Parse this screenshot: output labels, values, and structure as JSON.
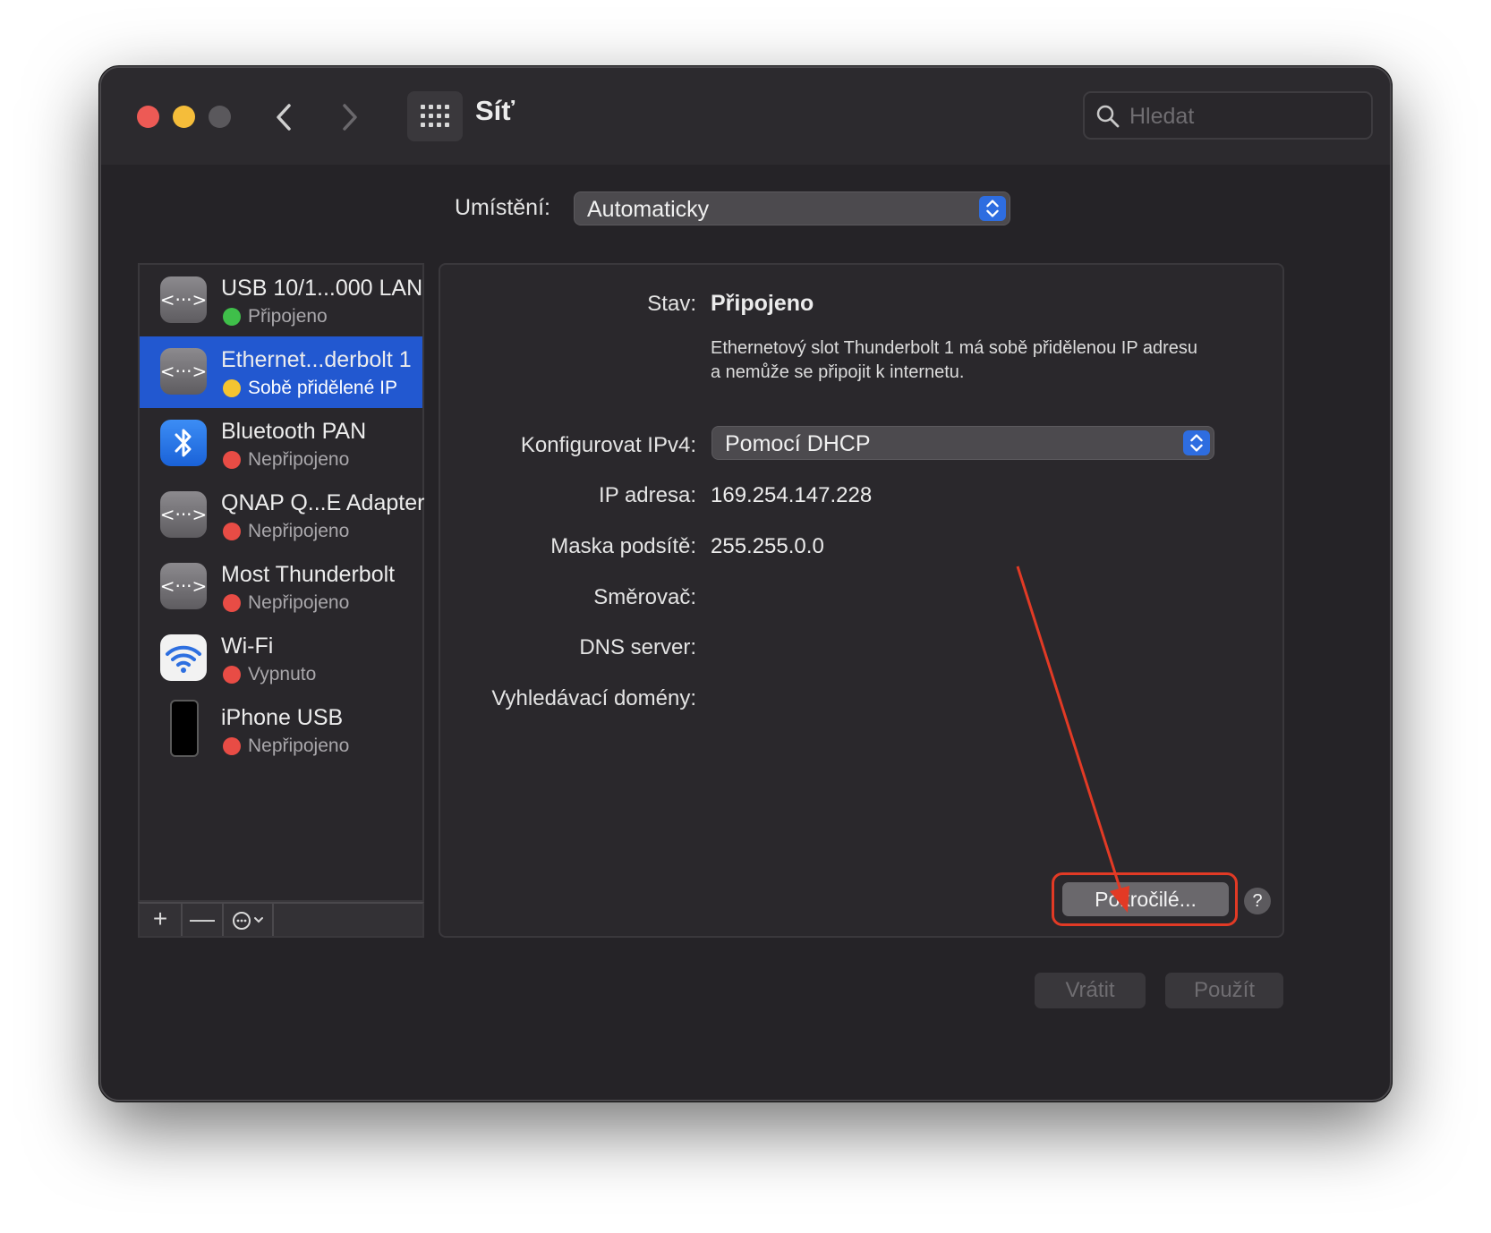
{
  "window": {
    "title": "Síť",
    "search_placeholder": "Hledat"
  },
  "location": {
    "label": "Umístění:",
    "value": "Automaticky"
  },
  "services": [
    {
      "name": "USB 10/1...000 LAN",
      "status": "Připojeno",
      "status_color": "#3fbf4a",
      "icon": "ethernet-icon",
      "selected": false
    },
    {
      "name": "Ethernet...derbolt 1",
      "status": "Sobě přidělené IP",
      "status_color": "#f4c430",
      "icon": "ethernet-icon",
      "selected": true
    },
    {
      "name": "Bluetooth PAN",
      "status": "Nepřipojeno",
      "status_color": "#e84c45",
      "icon": "bluetooth-icon",
      "selected": false
    },
    {
      "name": "QNAP Q...E Adapter",
      "status": "Nepřipojeno",
      "status_color": "#e84c45",
      "icon": "ethernet-icon",
      "selected": false
    },
    {
      "name": "Most Thunderbolt",
      "status": "Nepřipojeno",
      "status_color": "#e84c45",
      "icon": "ethernet-icon",
      "selected": false
    },
    {
      "name": "Wi-Fi",
      "status": "Vypnuto",
      "status_color": "#e84c45",
      "icon": "wifi-icon",
      "selected": false
    },
    {
      "name": "iPhone USB",
      "status": "Nepřipojeno",
      "status_color": "#e84c45",
      "icon": "iphone-icon",
      "selected": false
    }
  ],
  "sidebar_toolbar": {
    "add": "+",
    "remove": "—",
    "action": "⋯"
  },
  "detail": {
    "status_label": "Stav:",
    "status_value": "Připojeno",
    "status_desc": "Ethernetový slot Thunderbolt 1 má sobě přidělenou IP adresu a nemůže se připojit k internetu.",
    "ipv4_label": "Konfigurovat IPv4:",
    "ipv4_value": "Pomocí DHCP",
    "ip_label": "IP adresa:",
    "ip_value": "169.254.147.228",
    "mask_label": "Maska podsítě:",
    "mask_value": "255.255.0.0",
    "router_label": "Směrovač:",
    "router_value": "",
    "dns_label": "DNS server:",
    "dns_value": "",
    "domains_label": "Vyhledávací domény:",
    "domains_value": "",
    "advanced_button": "Pokročilé...",
    "help_button": "?"
  },
  "footer": {
    "revert": "Vrátit",
    "apply": "Použít"
  },
  "colors": {
    "accent": "#2258d0",
    "annotation": "#e23a25"
  }
}
